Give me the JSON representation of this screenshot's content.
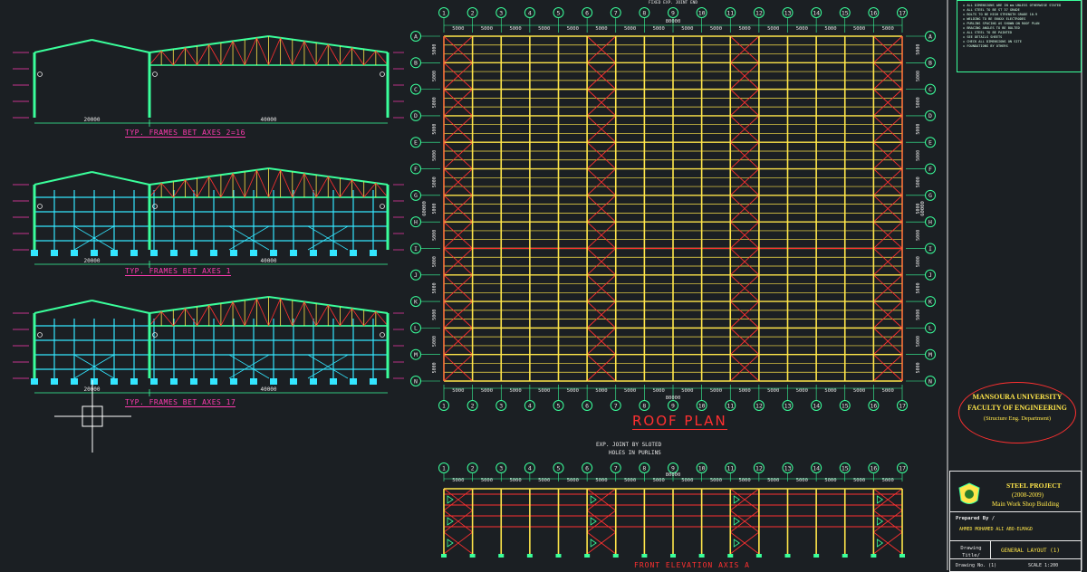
{
  "frames": [
    {
      "title": "TYP. FRAMES BET AXES 2=16",
      "dims": [
        "20000",
        "40000"
      ]
    },
    {
      "title": "TYP. FRAMES BET AXES 1",
      "dims": [
        "20000",
        "40000"
      ]
    },
    {
      "title": "TYP. FRAMES BET AXES  17",
      "dims": [
        "20000",
        "40000"
      ]
    }
  ],
  "roof_plan": {
    "title": "ROOF PLAN",
    "column_axes": [
      "1",
      "2",
      "3",
      "4",
      "5",
      "6",
      "7",
      "8",
      "9",
      "10",
      "11",
      "12",
      "13",
      "14",
      "15",
      "16",
      "17"
    ],
    "row_axes": [
      "A",
      "B",
      "C",
      "D",
      "E",
      "F",
      "G",
      "H",
      "I",
      "J",
      "K",
      "L",
      "M",
      "N"
    ],
    "bay_dim": "5000",
    "row_dim": "5000",
    "overall_dim": "80000",
    "top_note": "FIXED EXP. JOINT END",
    "side_dim": "60000"
  },
  "front_elevation": {
    "title": "FRONT ELEVATION AXIS A",
    "note_1": "EXP. JOINT BY SLOTED",
    "note_2": "HOLES IN PURLINS",
    "overall_dim": "80000"
  },
  "university": {
    "line_1": "MANSOURA UNIVERSITY",
    "line_2": "FACULTY OF ENGINEERING",
    "line_3": "(Structure Eng. Department)"
  },
  "title_block": {
    "project": "STEEL PROJECT",
    "years": "(2008-2009)",
    "building": "Main Work Shop Building",
    "prepared_by_label": "Prepared By /",
    "author": "AHMED MOHAMED ALI ABO-ELMAGD",
    "drawing_label": "Drawing Title/",
    "drawing_title": "GENERAL LAYOUT (1)",
    "drawing_no": "Drawing No. (1)",
    "scale": "SCALE 1:200"
  },
  "colors": {
    "background": "#1b1f23",
    "yellow": "#ffe64a",
    "cyan": "#33e6ff",
    "red": "#ff3030",
    "green": "#3aff9b",
    "magenta": "#ff3bb0",
    "white": "#e8e8e8"
  }
}
